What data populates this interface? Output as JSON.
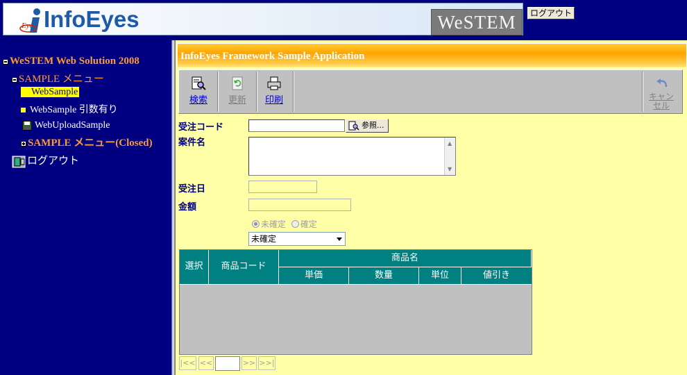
{
  "header": {
    "logo_text": "InfoEyes",
    "logo_small": "Eyes",
    "brand_badge": "WeSTEM",
    "logout_button": "ログアウト"
  },
  "nav": {
    "org": "WeSTEM Web Solution 2008",
    "menu_open": "SAMPLE メニュー",
    "items": [
      {
        "label": "WebSample",
        "selected": true
      },
      {
        "label": "WebSample 引数有り",
        "selected": false
      },
      {
        "label": "WebUploadSample",
        "selected": false
      }
    ],
    "menu_closed": "SAMPLE メニュー(Closed)",
    "logout": "ログアウト"
  },
  "main": {
    "title": "InfoEyes Framework Sample Application",
    "toolbar": {
      "search": "検索",
      "update": "更新",
      "print": "印刷",
      "cancel": "キャンセル"
    },
    "form": {
      "order_code_label": "受注コード",
      "order_code_value": "",
      "reference_button": "参照...",
      "case_name_label": "案件名",
      "case_name_value": "",
      "order_date_label": "受注日",
      "order_date_value": "",
      "amount_label": "金額",
      "amount_value": "",
      "radio_unconfirmed": "未確定",
      "radio_confirmed": "確定",
      "status_select": "未確定"
    },
    "grid": {
      "col_select": "選択",
      "col_product_code": "商品コード",
      "col_product_name": "商品名",
      "col_unit_price": "単価",
      "col_quantity": "数量",
      "col_unit": "単位",
      "col_discount": "値引き"
    },
    "pager": {
      "first": "|<<",
      "prev": "<<",
      "next": ">>",
      "last": ">>|",
      "page_value": ""
    }
  },
  "colors": {
    "background": "#000080",
    "main_bg": "#ffffa8",
    "nav_accent": "#ff9933",
    "grid_header": "#008080",
    "title_bar": "#ffa500"
  }
}
